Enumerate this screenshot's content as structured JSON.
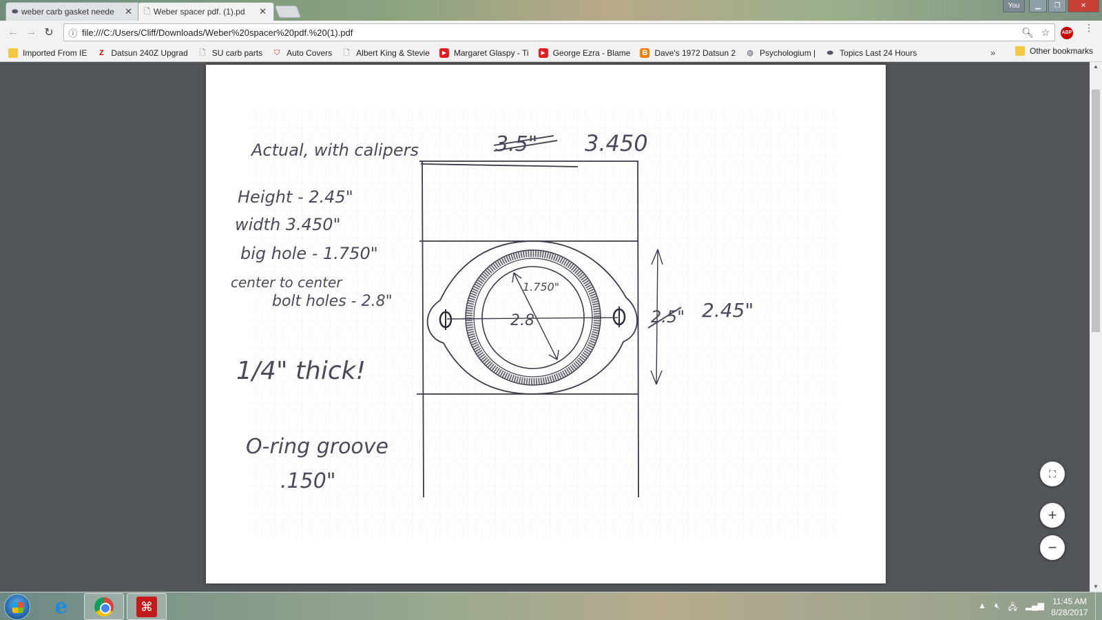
{
  "browser": {
    "tabs": [
      {
        "title": "weber carb gasket neede",
        "close": "✕"
      },
      {
        "title": "Weber spacer pdf. (1).pd",
        "close": "✕"
      }
    ],
    "window_controls": {
      "user": "You"
    },
    "url": "file:///C:/Users/Cliff/Downloads/Weber%20spacer%20pdf.%20(1).pdf"
  },
  "bookmarks": [
    {
      "label": "Imported From IE",
      "icon": "folder-icon"
    },
    {
      "label": "Datsun 240Z Upgrad",
      "icon": "datsun-icon"
    },
    {
      "label": "SU carb parts",
      "icon": "page-icon"
    },
    {
      "label": "Auto Covers",
      "icon": "shield-icon"
    },
    {
      "label": "Albert King & Stevie",
      "icon": "page-icon"
    },
    {
      "label": "Margaret Glaspy - Ti",
      "icon": "youtube-icon"
    },
    {
      "label": "George Ezra - Blame",
      "icon": "youtube-icon"
    },
    {
      "label": "Dave's 1972 Datsun 2",
      "icon": "blogger-icon"
    },
    {
      "label": "Psychologium |",
      "icon": "psychologium-icon"
    },
    {
      "label": "Topics Last 24 Hours",
      "icon": "oval-icon"
    }
  ],
  "bookmarks_overflow": "»",
  "other_bookmarks": "Other bookmarks",
  "drawing": {
    "title": "Actual, with calipers",
    "width_struck": "3.5\"",
    "width_value": "3.450",
    "notes": [
      "Height - 2.45\"",
      "width 3.450\"",
      "big hole - 1.750\"",
      "center to center",
      "bolt holes - 2.8\""
    ],
    "thickness": "1/4\" thick!",
    "oring_label": "O-ring groove",
    "oring_value": ".150\"",
    "hole_label": "1.750\"",
    "center_label": "2.8",
    "height_struck": "2.5\"",
    "height_value": "2.45\""
  },
  "taskbar": {
    "time": "11:45 AM",
    "date": "8/28/2017"
  }
}
